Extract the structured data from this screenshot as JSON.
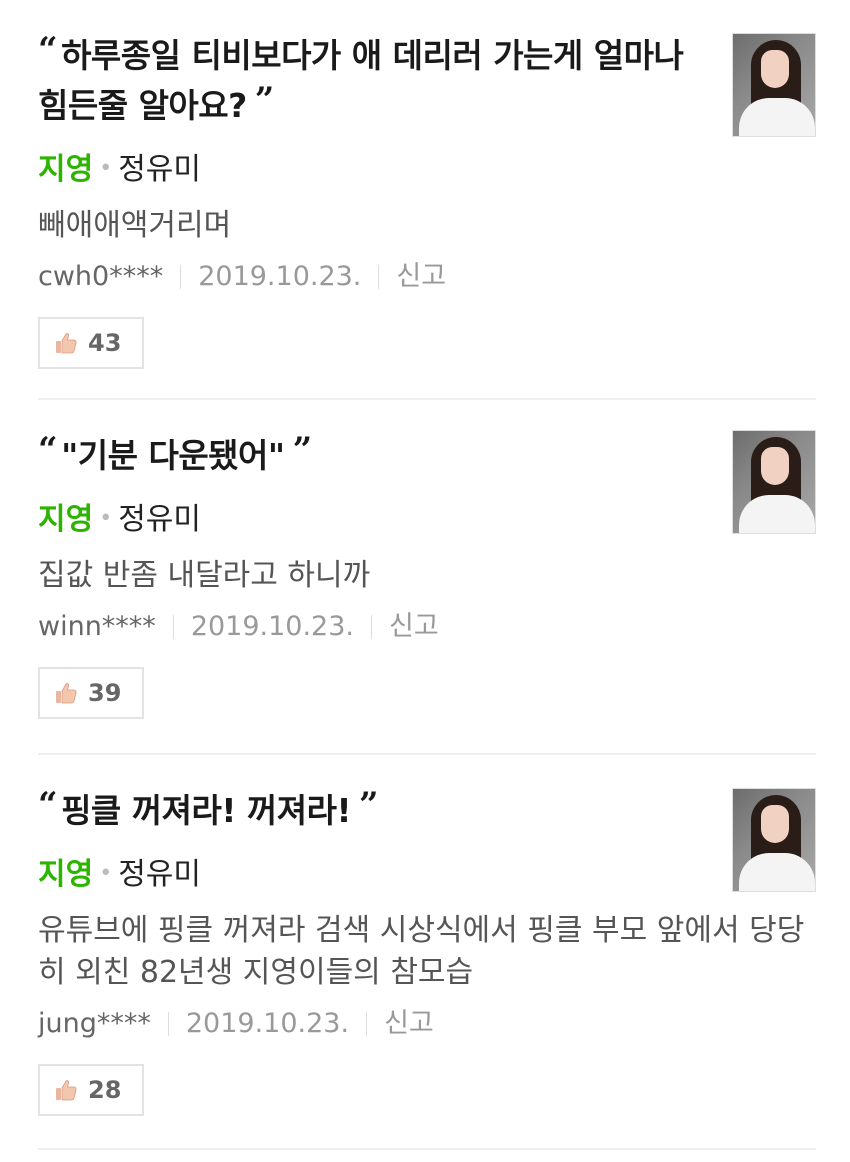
{
  "reviews": [
    {
      "quote": "하루종일 티비보다가 애 데리러 가는게 얼마나 힘든줄 알아요?",
      "movie": "지영",
      "person": "정유미",
      "text": "빼애애액거리며",
      "user": "cwh0****",
      "date": "2019.10.23.",
      "report": "신고",
      "likes": "43"
    },
    {
      "quote": "\"기분 다운됐어\"",
      "movie": "지영",
      "person": "정유미",
      "text": "집값 반좀 내달라고 하니까",
      "user": "winn****",
      "date": "2019.10.23.",
      "report": "신고",
      "likes": "39"
    },
    {
      "quote": "핑클 꺼져라! 꺼져라!",
      "movie": "지영",
      "person": "정유미",
      "text": "유튜브에 핑클 꺼져라 검색 시상식에서 핑클 부모 앞에서 당당히 외친 82년생 지영이들의 참모습",
      "user": "jung****",
      "date": "2019.10.23.",
      "report": "신고",
      "likes": "28"
    }
  ],
  "quote_open": "“",
  "quote_close": "”",
  "separator_dot": "•",
  "colors": {
    "movie_green": "#2db400",
    "divider": "#efefef",
    "muted_text": "#999999"
  },
  "icons": {
    "like": "thumbs-up-icon",
    "profile": "profile-photo"
  }
}
